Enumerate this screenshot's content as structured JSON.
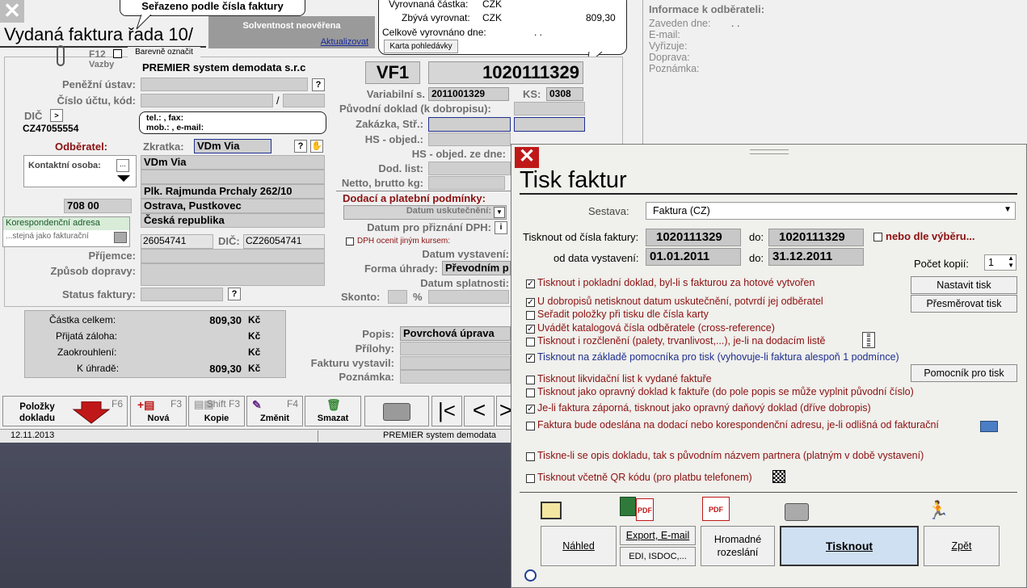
{
  "bg": {
    "title": "Vydaná faktura řada 10/",
    "close_glyph": "✕",
    "sort_callout": "Seřazeno podle čísla faktury",
    "solvency": {
      "text": "Solventnost neověřena",
      "link": "Aktualizovat"
    },
    "balance": {
      "l1": "Vyrovnaná částka:",
      "l1cur": "CZK",
      "l2": "Zbývá vyrovnat:",
      "l2cur": "CZK",
      "l2val": "809,30",
      "l3": "Celkově vyrovnáno dne:",
      "l3val": ". .",
      "btn": "Karta pohledávky"
    },
    "f12": "F12",
    "barevne": "Barevně označit",
    "vazby": "Vazby",
    "company": "PREMIER system demodata s.r.c",
    "penezni_ustav": "Peněžní ústav:",
    "cislo_uctu": "Číslo účtu, kód:",
    "dic": "DIČ",
    "dic_val": "CZ47055554",
    "contact_callout": {
      "l1": "tel.: , fax:",
      "l2": "mob.: , e-mail:"
    },
    "odberatel": "Odběratel:",
    "zkratka": "Zkratka:",
    "zkratka_val": "VDm Via",
    "kontaktni_osoba": "Kontaktní osoba:",
    "dots": "...",
    "addr": [
      "VDm Via",
      "",
      "Plk. Rajmunda Prchaly 262/10",
      "Ostrava, Pustkovec",
      "Česká republika"
    ],
    "psc": "708 00",
    "koresp": "Korespondenční adresa",
    "koresp_sub": "...stejná jako fakturační",
    "ico_val": "26054741",
    "dic2": "DIČ:",
    "dic2_val": "CZ26054741",
    "prijemce": "Příjemce:",
    "zpusob": "Způsob dopravy:",
    "status": "Status faktury:",
    "vf": "VF1",
    "number": "1020111329",
    "variabilni": "Variabilní s.",
    "variabilni_val": "2011001329",
    "ks": "KS:",
    "ks_val": "0308",
    "puvodni": "Původní doklad (k dobropisu):",
    "zakazka": "Zakázka, Stř.:",
    "hs_objed": "HS - objed.:",
    "hs_objed_dne": "HS - objed. ze dne:",
    "dod_list": "Dod. list:",
    "netto": "Netto, brutto kg:",
    "dodaci": "Dodací a platební podmínky:",
    "datum_usk": "Datum uskutečnění:",
    "datum_dph": "Datum pro přiznání DPH:",
    "dph_kurs": "DPH ocenit jiným kursem:",
    "datum_vyst": "Datum vystavení:",
    "forma": "Forma úhrady:",
    "forma_val": "Převodním p",
    "datum_splat": "Datum splatnosti:",
    "skonto": "Skonto:",
    "pct": "%",
    "totals": [
      {
        "l": "Částka celkem:",
        "v": "809,30",
        "c": "Kč"
      },
      {
        "l": "Přijatá záloha:",
        "v": "",
        "c": "Kč"
      },
      {
        "l": "Zaokrouhlení:",
        "v": "",
        "c": "Kč"
      },
      {
        "l": "K úhradě:",
        "v": "809,30",
        "c": "Kč"
      }
    ],
    "popis": "Popis:",
    "popis_val": "Povrchová úprava",
    "prilohy": "Přílohy:",
    "fakturu": "Fakturu vystavil:",
    "poznamka": "Poznámka:",
    "toolbar": [
      {
        "t": "Položky dokladu",
        "k": "F6"
      },
      {
        "t": "Nová",
        "k": "F3"
      },
      {
        "t": "Kopie",
        "k": "Shift F3"
      },
      {
        "t": "Změnit",
        "k": "F4"
      },
      {
        "t": "Smazat",
        "k": ""
      }
    ],
    "status_date": "12.11.2013",
    "status_company": "PREMIER system demodata"
  },
  "info": {
    "title": "Informace k odběrateli:",
    "rows": [
      "Zaveden dne:",
      "E-mail:",
      "Vyřizuje:",
      "Doprava:",
      "Poznámka:"
    ],
    "zaveden_val": ". ."
  },
  "dialog": {
    "title": "Tisk faktur",
    "sestava_label": "Sestava:",
    "sestava_val": "Faktura (CZ)",
    "od_cisla": "Tisknout od čísla faktury:",
    "od_cisla_val": "1020111329",
    "do": "do:",
    "do_cisla_val": "1020111329",
    "nebo": "nebo dle výběru...",
    "od_data": "od data vystavení:",
    "od_data_val": "01.01.2011",
    "do_data_val": "31.12.2011",
    "kopie": "Počet kopií:",
    "kopie_val": "1",
    "btn_nastavit": "Nastavit tisk",
    "btn_presmerovat": "Přesměrovat tisk",
    "btn_pomocnik": "Pomocník pro tisk",
    "options": [
      {
        "t": "Tisknout i pokladní doklad, byl-li s fakturou za hotové vytvořen",
        "c": true
      },
      {
        "t": "U dobropisů netisknout datum uskutečnění, potvrdí jej odběratel",
        "c": true
      },
      {
        "t": "Seřadit položky při tisku dle čísla karty",
        "c": false
      },
      {
        "t": "Uvádět katalogová čísla odběratele (cross-reference)",
        "c": true
      },
      {
        "t": "Tisknout i rozčlenění (palety, trvanlivost,...), je-li na dodacím listě",
        "c": false
      },
      {
        "t": "Tisknout na základě pomocníka pro tisk (vyhovuje-li faktura alespoň 1 podmínce)",
        "c": true
      },
      {
        "t": "Tisknout likvidační list k vydané faktuře",
        "c": false
      },
      {
        "t": "Tisknout jako opravný doklad k faktuře (do pole popis se může vyplnit původní číslo)",
        "c": false
      },
      {
        "t": "Je-li faktura záporná, tisknout jako opravný daňový doklad (dříve dobropis)",
        "c": true
      },
      {
        "t": "Faktura bude odeslána na dodací nebo korespondenční adresu, je-li odlišná od fakturační",
        "c": false
      },
      {
        "t": "Tiskne-li se opis dokladu, tak s původním názvem partnera (platným v době vystavení)",
        "c": false
      },
      {
        "t": "Tisknout včetně QR kódu (pro platbu telefonem)",
        "c": false
      }
    ],
    "btn_nahled": "Náhled",
    "btn_export": "Export, E-mail",
    "btn_edi": "EDI, ISDOC,...",
    "btn_hromadne": "Hromadné rozeslání",
    "btn_tisknout": "Tisknout",
    "btn_zpet": "Zpět",
    "colors": {
      "text": "#8b1010",
      "blue": "#1f2f8f",
      "close": "#c01818",
      "print_btn": "#cfe0f2"
    }
  }
}
